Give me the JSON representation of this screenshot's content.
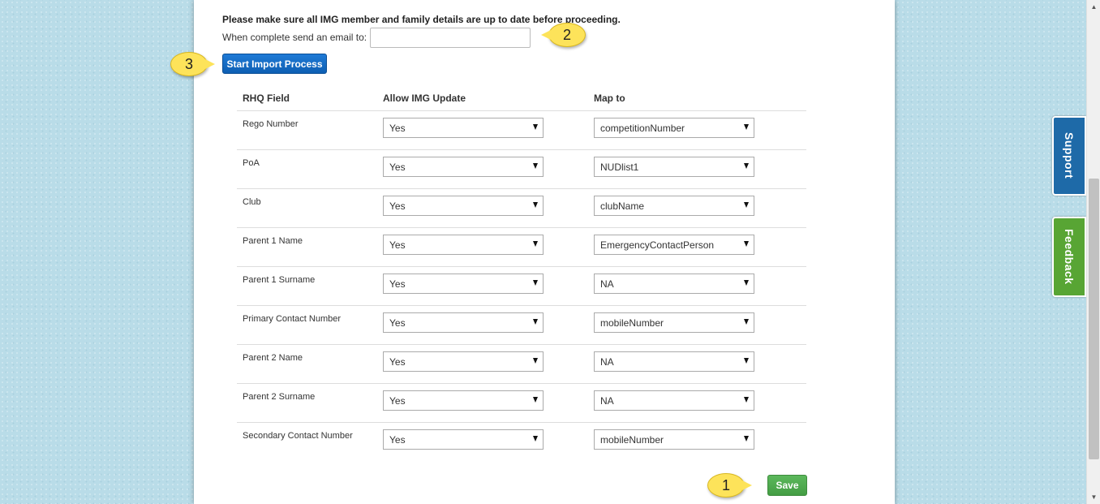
{
  "notice": "Please make sure all IMG member and family details are up to date before proceeding.",
  "email": {
    "label": "When complete send an email to:",
    "value": ""
  },
  "start_button": "Start Import Process",
  "table": {
    "headers": [
      "RHQ Field",
      "Allow IMG Update",
      "Map to"
    ],
    "rows": [
      {
        "field": "Rego Number",
        "allow": "Yes",
        "map": "competitionNumber"
      },
      {
        "field": "PoA",
        "allow": "Yes",
        "map": "NUDlist1"
      },
      {
        "field": "Club",
        "allow": "Yes",
        "map": "clubName"
      },
      {
        "field": "Parent 1 Name",
        "allow": "Yes",
        "map": "EmergencyContactPerson"
      },
      {
        "field": "Parent 1 Surname",
        "allow": "Yes",
        "map": "NA"
      },
      {
        "field": "Primary Contact Number",
        "allow": "Yes",
        "map": "mobileNumber"
      },
      {
        "field": "Parent 2 Name",
        "allow": "Yes",
        "map": "NA"
      },
      {
        "field": "Parent 2 Surname",
        "allow": "Yes",
        "map": "NA"
      },
      {
        "field": "Secondary Contact Number",
        "allow": "Yes",
        "map": "mobileNumber"
      }
    ]
  },
  "save_button": "Save",
  "callouts": {
    "one": "1",
    "two": "2",
    "three": "3"
  },
  "side_tabs": {
    "support": "Support",
    "feedback": "Feedback"
  },
  "colors": {
    "background": "#b9dce8",
    "primary_button": "#1f7ad6",
    "save_button": "#5cb85c",
    "support_tab": "#1e6aa8",
    "feedback_tab": "#58a534",
    "callout": "#fde35a"
  },
  "icons": {
    "dropdown": "chevron-down-icon",
    "scroll_up": "scroll-up-icon",
    "scroll_down": "scroll-down-icon"
  }
}
